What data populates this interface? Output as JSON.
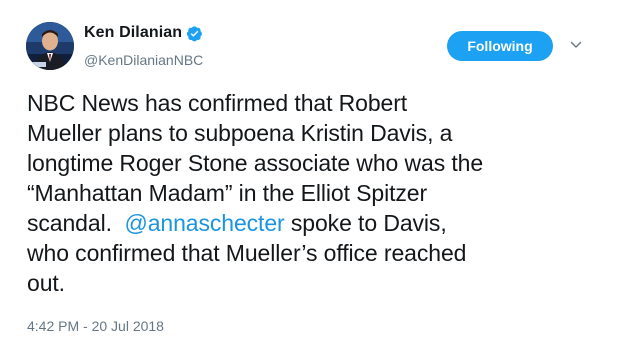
{
  "author": {
    "display_name": "Ken Dilanian",
    "handle": "@KenDilanianNBC",
    "avatar_icon": "news-anchor-avatar",
    "verified_icon": "verified-badge-icon"
  },
  "follow_button": {
    "label": "Following"
  },
  "menu": {
    "icon": "chevron-down-icon"
  },
  "tweet": {
    "line1": "NBC News has confirmed that Robert",
    "line2": "Mueller plans to subpoena Kristin Davis, a",
    "line3": "longtime Roger Stone associate who was the",
    "line4": "“Manhattan Madam” in the Elliot Spitzer",
    "line5_pre": "scandal.  ",
    "mention": "@annaschecter",
    "line5_post": " spoke to Davis,",
    "line6": "who confirmed that Mueller’s office reached",
    "line7": "out."
  },
  "timestamp": "4:42 PM - 20 Jul 2018",
  "colors": {
    "accent": "#1da1f2",
    "link": "#1b95e0",
    "text": "#14171a",
    "secondary": "#657786"
  }
}
